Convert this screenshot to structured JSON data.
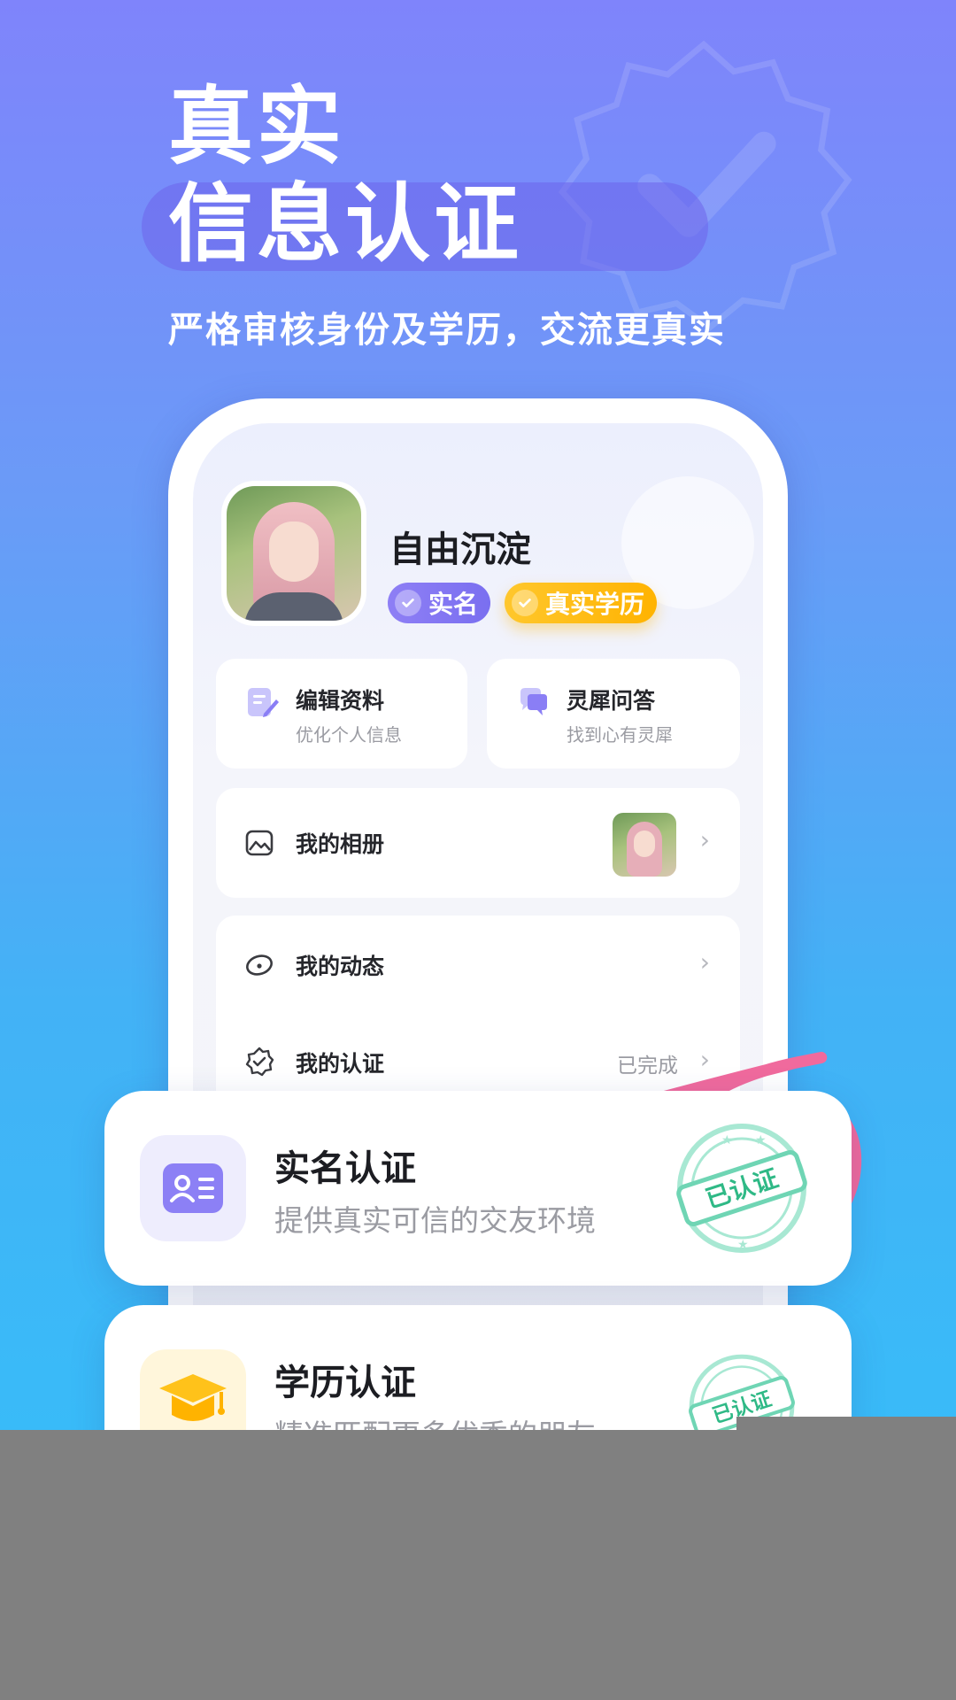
{
  "hero": {
    "title_line1": "真实",
    "title_line2": "信息认证",
    "subtitle": "严格审核身份及学历，交流更真实"
  },
  "profile": {
    "username": "自由沉淀",
    "tags": [
      {
        "label": "实名",
        "color": "#7f74f2"
      },
      {
        "label": "真实学历",
        "color": "#ffbb0f"
      }
    ]
  },
  "quick_cards": [
    {
      "title": "编辑资料",
      "subtitle": "优化个人信息",
      "icon": "edit-profile-icon"
    },
    {
      "title": "灵犀问答",
      "subtitle": "找到心有灵犀",
      "icon": "chat-bubble-icon"
    }
  ],
  "menu": {
    "album": {
      "label": "我的相册",
      "icon": "photo-icon"
    },
    "moments": {
      "label": "我的动态",
      "icon": "moments-icon"
    },
    "certification": {
      "label": "我的认证",
      "status": "已完成",
      "icon": "certified-badge-icon"
    }
  },
  "cert_cards": [
    {
      "title": "实名认证",
      "subtitle": "提供真实可信的交友环境",
      "stamp": "已认证",
      "icon": "id-card-icon"
    },
    {
      "title": "学历认证",
      "subtitle": "精准匹配更多优秀的朋友",
      "stamp": "已认证",
      "icon": "graduation-cap-icon"
    }
  ],
  "colors": {
    "accent_purple": "#7f74f2",
    "accent_yellow": "#ffbb0f",
    "stamp_green": "#49c9a0",
    "highlight_pink": "#f06a9d"
  }
}
